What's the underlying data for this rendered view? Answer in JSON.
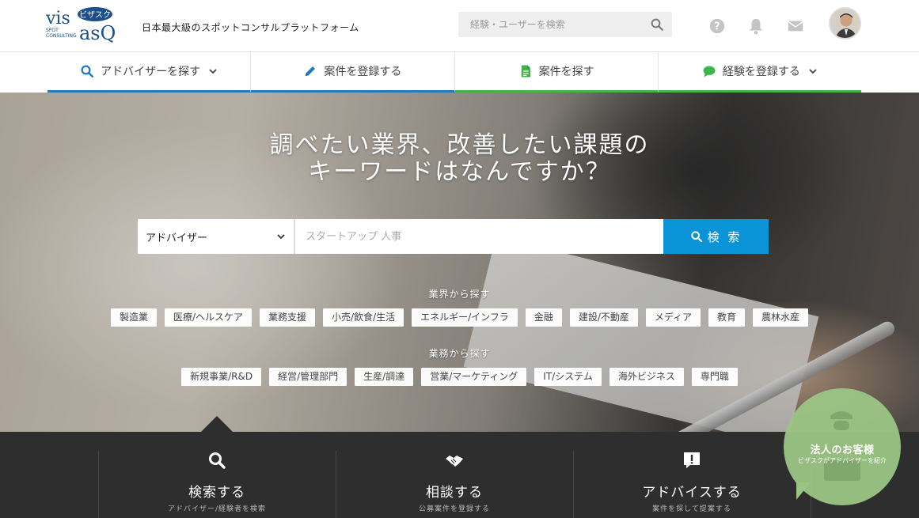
{
  "header": {
    "logo_top": "vis",
    "logo_badge": "ビザスク",
    "logo_bottom": "asQ",
    "logo_spot": "SPOT",
    "logo_consulting": "CONSULTING",
    "tagline": "日本最大級のスポットコンサルプラットフォーム",
    "search_placeholder": "経験・ユーザーを検索",
    "icons": [
      "help-icon",
      "bell-icon",
      "mail-icon"
    ]
  },
  "nav": [
    {
      "label": "アドバイザーを探す",
      "icon": "search-icon",
      "accent": "#1d7bc4",
      "dropdown": true
    },
    {
      "label": "案件を登録する",
      "icon": "pencil-icon",
      "accent": "#1d7bc4",
      "dropdown": false
    },
    {
      "label": "案件を探す",
      "icon": "document-icon",
      "accent": "#3cb54a",
      "dropdown": false
    },
    {
      "label": "経験を登録する",
      "icon": "chat-icon",
      "accent": "#3cb54a",
      "dropdown": true
    }
  ],
  "hero": {
    "title_line1": "調べたい業界、改善したい課題の",
    "title_line2": "キーワードはなんですか？",
    "select_value": "アドバイザー",
    "input_placeholder": "スタートアップ 人事",
    "search_button": "検 索",
    "industry_label": "業界から探す",
    "industry_tags": [
      "製造業",
      "医療/ヘルスケア",
      "業務支援",
      "小売/飲食/生活",
      "エネルギー/インフラ",
      "金融",
      "建設/不動産",
      "メディア",
      "教育",
      "農林水産"
    ],
    "function_label": "業務から探す",
    "function_tags": [
      "新規事業/R&D",
      "経営/管理部門",
      "生産/調達",
      "営業/マーケティング",
      "IT/システム",
      "海外ビジネス",
      "専門職"
    ]
  },
  "band": [
    {
      "title": "検索する",
      "sub": "アドバイザー/経験者を検索",
      "icon": "search-icon"
    },
    {
      "title": "相談する",
      "sub": "公募案件を登録する",
      "icon": "handshake-icon"
    },
    {
      "title": "アドバイスする",
      "sub": "案件を探して提案する",
      "icon": "exclamation-icon"
    }
  ],
  "corporate": {
    "title": "法人のお客様",
    "sub": "ビザスクがアドバイザーを紹介"
  },
  "colors": {
    "primary_blue": "#0b93d8",
    "nav_blue": "#1d7bc4",
    "nav_green": "#3cb54a",
    "band_bg": "#2e2e2e",
    "corp_green": "#9bc484"
  }
}
